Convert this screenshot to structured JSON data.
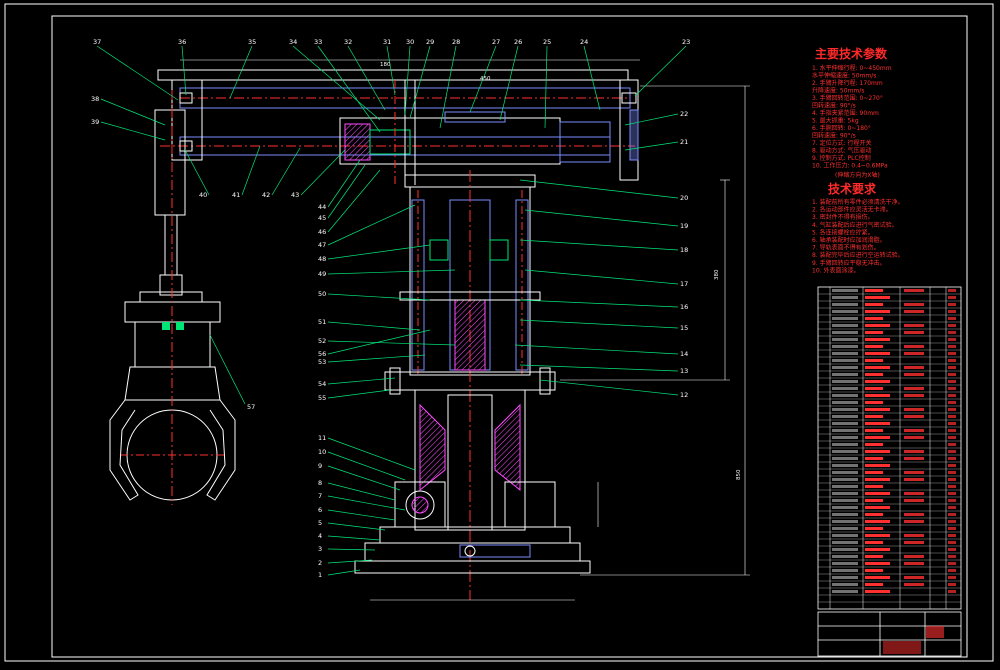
{
  "drawing": {
    "params_title": "主要技术参数",
    "params_lines": [
      "1. 水平伸缩行程: 0~450mm",
      "   水平伸缩速度: 50mm/s",
      "2. 手臂升降行程: 170mm",
      "   升降速度: 50mm/s",
      "3. 手臂回转范围: 0~270°",
      "   回转速度: 90°/s",
      "4. 手指夹紧范围: 90mm",
      "5. 最大抓重: 5kg",
      "6. 手腕回转: 0~180°",
      "   回转速度: 90°/s",
      "7. 定位方式: 行程开关",
      "8. 驱动方式: 气压驱动",
      "9. 控制方式: PLC控制",
      "10. 工作压力: 0.4~0.6MPa"
    ],
    "params_note": "(伸缩方向为X轴)",
    "req_title": "技术要求",
    "req_lines": [
      "1. 装配前所有零件必须清洗干净。",
      "2. 各运动部件应灵活无卡滞。",
      "3. 密封件不得有损伤。",
      "4. 气缸装配后应进行气密试验。",
      "5. 各连接螺栓应拧紧。",
      "6. 轴承装配时应加润滑脂。",
      "7. 导轨表面不得有划伤。",
      "8. 装配完毕后应进行空运转试验。",
      "9. 手臂回转应平稳无冲击。",
      "10. 外表面涂漆。"
    ],
    "balloons_top": [
      "37",
      "36",
      "35",
      "34",
      "33",
      "32",
      "31",
      "30",
      "29",
      "28",
      "27",
      "26",
      "25",
      "24",
      "23"
    ],
    "balloons_left": [
      "38",
      "39",
      "40",
      "41",
      "42",
      "43",
      "44",
      "45",
      "46",
      "47",
      "48",
      "49",
      "50",
      "51",
      "52",
      "53",
      "54",
      "55",
      "56"
    ],
    "balloons_lower_left": [
      "11",
      "10",
      "9",
      "8",
      "7",
      "6",
      "5",
      "4",
      "3",
      "2",
      "1"
    ],
    "balloons_right": [
      "22",
      "21",
      "20",
      "19",
      "18",
      "17",
      "16",
      "15",
      "14",
      "13",
      "12"
    ],
    "balloon_57": "57",
    "dim_top_1": "180",
    "dim_top_2": "450",
    "dim_right_1": "380",
    "dim_right_2": "850"
  },
  "colors": {
    "background": "#000000",
    "outline": "#ffffff",
    "parts": "#7b8cff",
    "centerline": "#ff3030",
    "leader": "#00e676",
    "hatch": "#ff4cff",
    "table_accent": "#ff3030"
  }
}
